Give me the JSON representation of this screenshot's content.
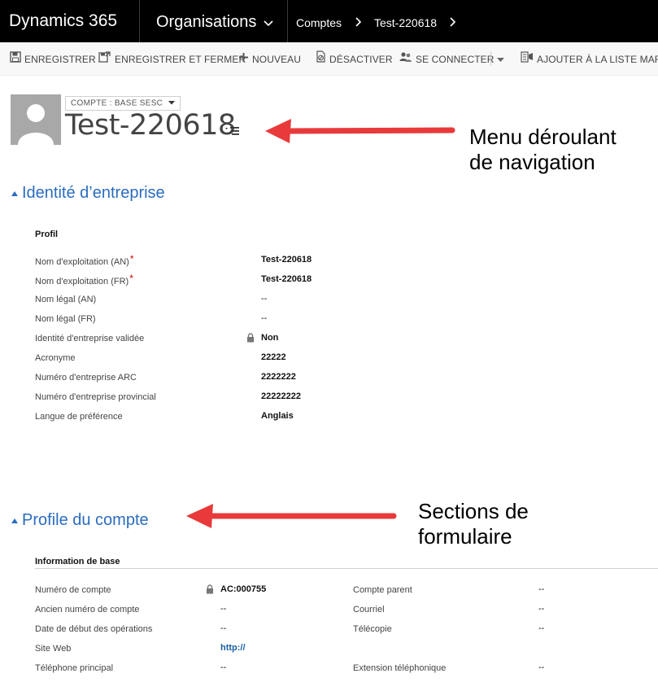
{
  "topnav": {
    "brand": "Dynamics 365",
    "area": "Organisations",
    "crumbs": [
      "Comptes",
      "Test-220618"
    ]
  },
  "commands": {
    "save": "ENREGISTRER",
    "save_close": "ENREGISTRER ET FERMER",
    "new": "NOUVEAU",
    "deactivate": "DÉSACTIVER",
    "connect": "SE CONNECTER",
    "add_marketing": "AJOUTER À LA LISTE MAR..."
  },
  "header": {
    "form_selector": "COMPTE : BASE SESC",
    "record_title": "Test-220618"
  },
  "annotations": {
    "nav_menu": [
      "Menu déroulant",
      "de navigation"
    ],
    "sections": [
      "Sections de",
      "formulaire"
    ]
  },
  "section1": {
    "title": "Identité d’entreprise",
    "subheading": "Profil",
    "fields": [
      {
        "label": "Nom d'exploitation (AN)",
        "value": "Test-220618"
      },
      {
        "label": "Nom d'exploitation (FR)",
        "value": "Test-220618"
      },
      {
        "label": "Nom légal (AN)",
        "value": "--"
      },
      {
        "label": "Nom légal (FR)",
        "value": "--"
      },
      {
        "label": "Identité d'entreprise validée",
        "value": "Non"
      },
      {
        "label": "Acronyme",
        "value": "22222"
      },
      {
        "label": "Numéro d'entreprise ARC",
        "value": "2222222"
      },
      {
        "label": "Numéro d'entreprise provincial",
        "value": "22222222"
      },
      {
        "label": "Langue de préférence",
        "value": "Anglais"
      }
    ]
  },
  "section2": {
    "title": "Profile du compte",
    "subheading": "Information de base",
    "left": [
      {
        "label": "Numéro de compte",
        "value": "AC:000755"
      },
      {
        "label": "Ancien numéro de compte",
        "value": "--"
      },
      {
        "label": "Date de début des opérations",
        "value": "--"
      },
      {
        "label": "Site Web",
        "value": "http://"
      },
      {
        "label": "Téléphone principal",
        "value": "--"
      }
    ],
    "right": [
      {
        "label": "Compte parent",
        "value": "--"
      },
      {
        "label": "Courriel",
        "value": "--"
      },
      {
        "label": "Télécopie",
        "value": "--"
      },
      {
        "label": "Extension téléphonique",
        "value": "--"
      }
    ]
  },
  "colors": {
    "accent_blue": "#2a6cbf",
    "arrow_red": "#e83a3a",
    "nav_black": "#000000"
  }
}
